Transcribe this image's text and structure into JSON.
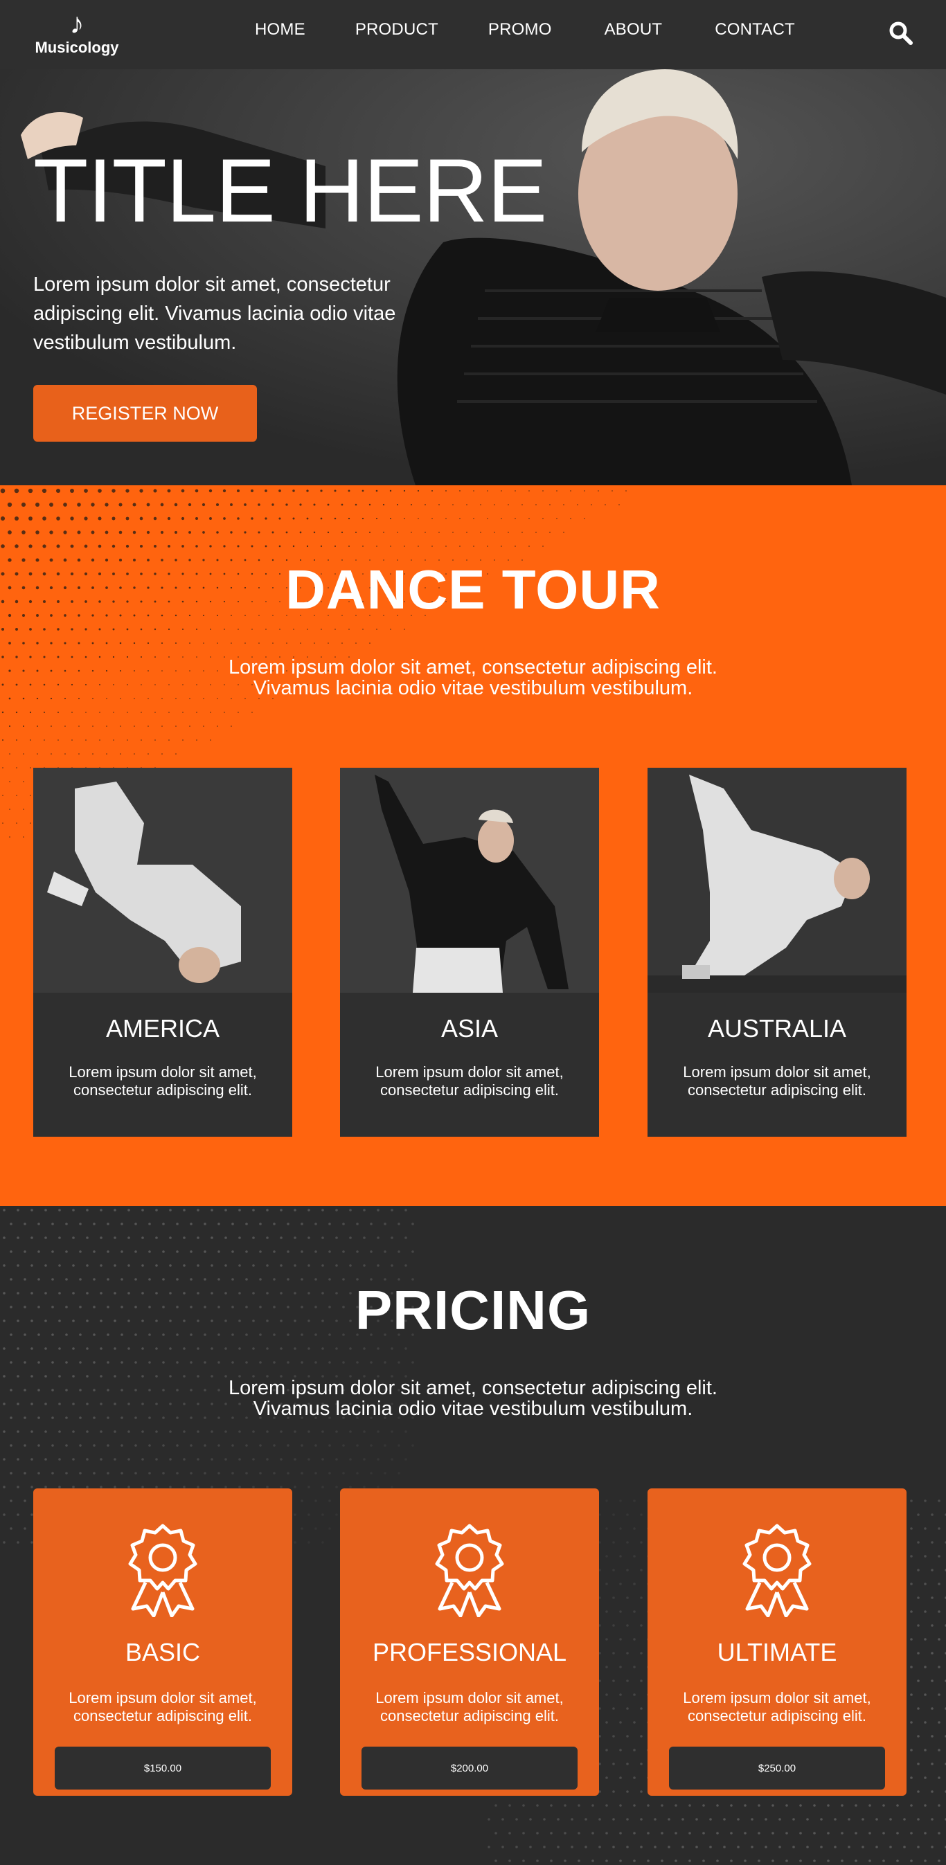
{
  "brand": {
    "name": "Musicology",
    "logo_icon": "music-note-icon"
  },
  "nav": {
    "items": [
      "HOME",
      "PRODUCT",
      "PROMO",
      "ABOUT",
      "CONTACT"
    ],
    "search_icon": "search-icon"
  },
  "hero": {
    "title": "TITLE HERE",
    "text": "Lorem ipsum dolor sit amet, consectetur adipiscing elit. Vivamus lacinia odio vitae vestibulum vestibulum.",
    "button": "REGISTER NOW"
  },
  "tour": {
    "title": "DANCE TOUR",
    "text_line1": "Lorem ipsum dolor sit amet, consectetur adipiscing elit.",
    "text_line2": "Vivamus lacinia odio vitae vestibulum vestibulum.",
    "cards": [
      {
        "title": "AMERICA",
        "text": "Lorem ipsum dolor sit amet, consectetur adipiscing elit."
      },
      {
        "title": "ASIA",
        "text": "Lorem ipsum dolor sit amet, consectetur adipiscing elit."
      },
      {
        "title": "AUSTRALIA",
        "text": "Lorem ipsum dolor sit amet, consectetur adipiscing elit."
      }
    ]
  },
  "pricing": {
    "title": "PRICING",
    "text_line1": "Lorem ipsum dolor sit amet, consectetur adipiscing elit.",
    "text_line2": "Vivamus lacinia odio vitae vestibulum vestibulum.",
    "plans": [
      {
        "title": "BASIC",
        "text": "Lorem ipsum dolor sit amet, consectetur adipiscing elit.",
        "price": "$150.00",
        "icon": "award-ribbon-icon"
      },
      {
        "title": "PROFESSIONAL",
        "text": "Lorem ipsum dolor sit amet, consectetur adipiscing elit.",
        "price": "$200.00",
        "icon": "award-ribbon-icon"
      },
      {
        "title": "ULTIMATE",
        "text": "Lorem ipsum dolor sit amet, consectetur adipiscing elit.",
        "price": "$250.00",
        "icon": "award-ribbon-icon"
      }
    ]
  },
  "colors": {
    "accent": "#ff640f",
    "accent_card": "#e8621e",
    "dark": "#2f2f2f",
    "page_bg": "#2b2b2b",
    "text": "#ffffff"
  }
}
